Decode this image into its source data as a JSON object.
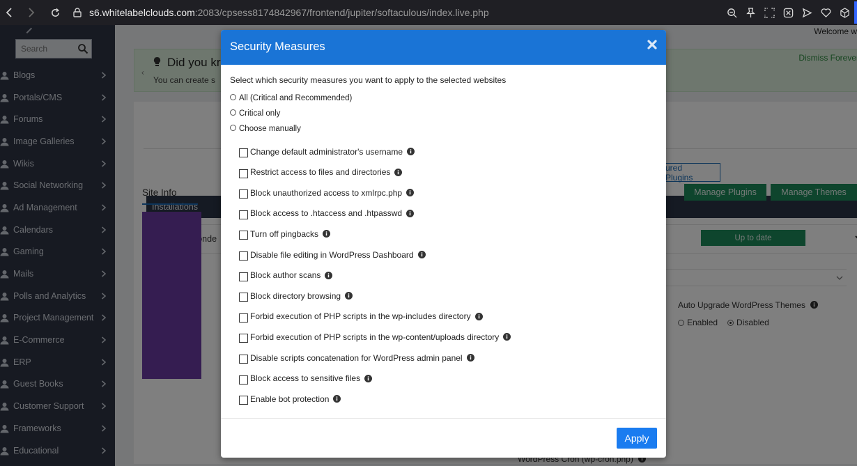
{
  "browser": {
    "url_host": "s6.whitelabelclouds.com",
    "url_rest": ":2083/cpsess8174842967/frontend/jupiter/softaculous/index.live.php"
  },
  "sidebar": {
    "search_placeholder": "Search",
    "items": [
      {
        "label": "Blogs",
        "icon": "user-icon"
      },
      {
        "label": "Portals/CMS",
        "icon": "portal-icon"
      },
      {
        "label": "Forums",
        "icon": "users-icon"
      },
      {
        "label": "Image Galleries",
        "icon": "image-icon"
      },
      {
        "label": "Wikis",
        "icon": "globe-icon"
      },
      {
        "label": "Social Networking",
        "icon": "comments-icon"
      },
      {
        "label": "Ad Management",
        "icon": "megaphone-icon"
      },
      {
        "label": "Calendars",
        "icon": "calendar-icon"
      },
      {
        "label": "Gaming",
        "icon": "gamepad-icon"
      },
      {
        "label": "Mails",
        "icon": "envelope-icon"
      },
      {
        "label": "Polls and Analytics",
        "icon": "pie-chart-icon"
      },
      {
        "label": "Project Management",
        "icon": "edit-icon"
      },
      {
        "label": "E-Commerce",
        "icon": "cart-icon"
      },
      {
        "label": "ERP",
        "icon": "bar-chart-icon"
      },
      {
        "label": "Guest Books",
        "icon": "book-icon"
      },
      {
        "label": "Customer Support",
        "icon": "lifebuoy-icon"
      },
      {
        "label": "Frameworks",
        "icon": "cogs-icon"
      },
      {
        "label": "Educational",
        "icon": "graduation-cap-icon"
      }
    ]
  },
  "background": {
    "welcome": "Welcome w",
    "tip_title": "Did you kr",
    "tip_text": "You can create s",
    "dismiss": "Dismiss Forever",
    "featured_plugins": "ured Plugins",
    "installations": "Installations",
    "install_url": "http://webwonde",
    "up_to_date": "Up to date",
    "site_info_tab": "Site Info",
    "manage_plugins": "Manage Plugins",
    "manage_themes": "Manage Themes",
    "auto_upgrade_label": "Auto Upgrade WordPress Themes",
    "enabled": "Enabled",
    "disabled": "Disabled",
    "cron_label": "WordPress Cron (wp-cron.php)"
  },
  "modal": {
    "title": "Security Measures",
    "intro": "Select which security measures you want to apply to the selected websites",
    "radios": [
      "All (Critical and Recommended)",
      "Critical only",
      "Choose manually"
    ],
    "checks": [
      "Change default administrator's username",
      "Restrict access to files and directories",
      "Block unauthorized access to xmlrpc.php",
      "Block access to .htaccess and .htpasswd",
      "Turn off pingbacks",
      "Disable file editing in WordPress Dashboard",
      "Block author scans",
      "Block directory browsing",
      "Forbid execution of PHP scripts in the wp-includes directory",
      "Forbid execution of PHP scripts in the wp-content/uploads directory",
      "Disable scripts concatenation for WordPress admin panel",
      "Block access to sensitive files",
      "Enable bot protection"
    ],
    "apply": "Apply"
  },
  "colors": {
    "modal_header": "#1a74d6",
    "apply_button": "#1a7cf0",
    "sidebar_bg": "#2e3545",
    "success_green": "#1c8a5a"
  }
}
